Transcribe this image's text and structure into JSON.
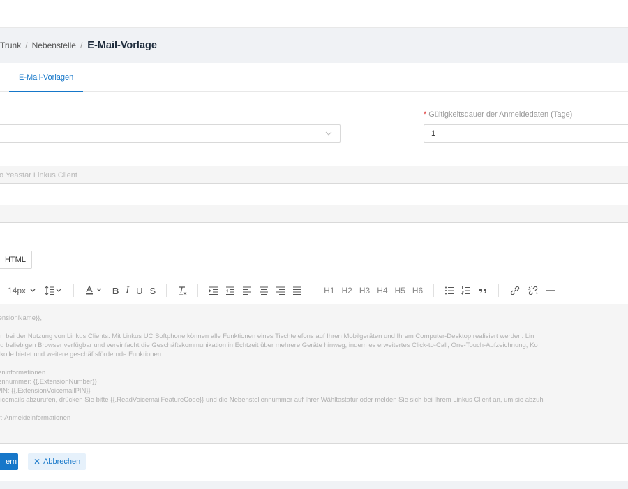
{
  "breadcrumb": {
    "trunk": "Trunk",
    "extension": "Nebenstelle",
    "title": "E-Mail-Vorlage"
  },
  "tabs": [
    {
      "label": "E-Mail-Vorlagen",
      "active": true
    }
  ],
  "form": {
    "validity_label": "Gültigkeitsdauer der Anmeldedaten (Tage)",
    "validity_required": "*",
    "validity_value": "1",
    "subject_value": "o Yeastar Linkus Client",
    "html_button": "HTML"
  },
  "toolbar": {
    "font_size": "14px",
    "headings": [
      "H1",
      "H2",
      "H3",
      "H4",
      "H5",
      "H6"
    ],
    "bold": "B",
    "italic": "I",
    "underline": "U",
    "strike": "S"
  },
  "editor": {
    "lines": [
      "tensionName}},",
      "",
      "en bei der Nutzung von Linkus Clients. Mit Linkus UC Softphone können alle Funktionen eines Tischtelefons auf Ihren Mobilgeräten und Ihrem Computer-Desktop realisiert werden. Lin",
      "nd beliebigen Browser verfügbar und vereinfacht die Geschäftskommunikation in Echtzeit über mehrere Geräte hinweg, indem es erweitertes Click-to-Call, One-Touch-Aufzeichnung, Ko",
      "okolle bietet und weitere geschäftsfördernde Funktionen.",
      "",
      "leninformationen",
      "lennummer: {{.ExtensionNumber}}",
      "PIN: {{.ExtensionVoicemailPIN}}",
      "oicemails abzurufen, drücken Sie bitte {{.ReadVoicemailFeatureCode}} und die Nebenstellennummer auf Ihrer Wähltastatur oder melden Sie sich bei Ihrem Linkus Client an, um sie abzuh",
      "",
      "nt-Anmeldeinformationen"
    ]
  },
  "actions": {
    "save_label": "ern",
    "cancel_label": "Abbrechen"
  },
  "colors": {
    "accent": "#1677c9",
    "required": "#e04040"
  }
}
